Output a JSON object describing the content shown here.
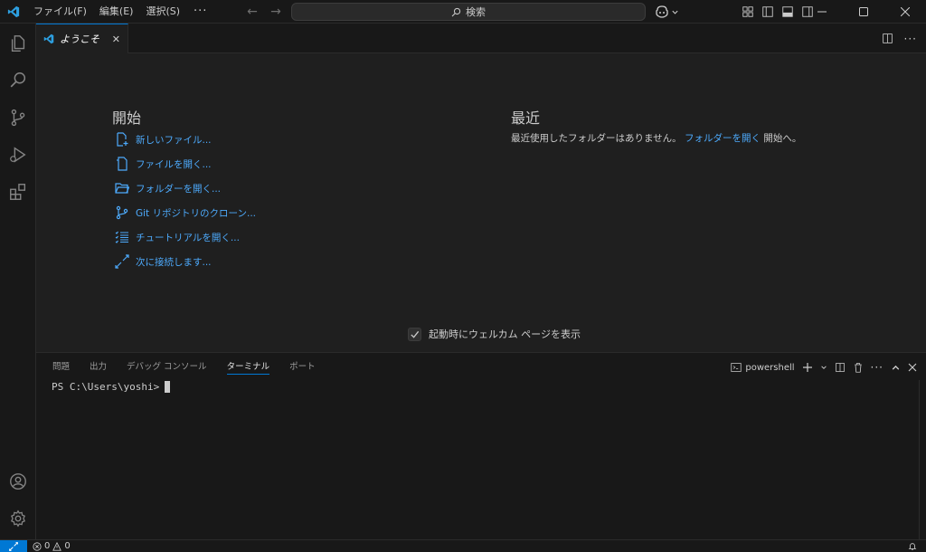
{
  "titlebar": {
    "menu": [
      "ファイル(F)",
      "編集(E)",
      "選択(S)"
    ],
    "more": "···",
    "search_label": "検索"
  },
  "tab": {
    "label": "ようこそ"
  },
  "welcome": {
    "start_title": "開始",
    "start_items": [
      {
        "icon": "new-file-icon",
        "label": "新しいファイル..."
      },
      {
        "icon": "open-file-icon",
        "label": "ファイルを開く..."
      },
      {
        "icon": "folder-open-icon",
        "label": "フォルダーを開く..."
      },
      {
        "icon": "git-clone-icon",
        "label": "Git リポジトリのクローン..."
      },
      {
        "icon": "checklist-icon",
        "label": "チュートリアルを開く..."
      },
      {
        "icon": "remote-connect-icon",
        "label": "次に接続します..."
      }
    ],
    "recent_title": "最近",
    "recent_text": "最近使用したフォルダーはありません。",
    "recent_link": "フォルダーを開く",
    "recent_suffix": "開始へ。",
    "show_on_startup": "起動時にウェルカム ページを表示"
  },
  "panel": {
    "tabs": [
      "問題",
      "出力",
      "デバッグ コンソール",
      "ターミナル",
      "ポート"
    ],
    "active_tab": "ターミナル",
    "shell": "powershell",
    "prompt": "PS C:\\Users\\yoshi>"
  },
  "status": {
    "errors": "0",
    "warnings": "0"
  },
  "colors": {
    "accent": "#0078d4",
    "link": "#4daafc",
    "background": "#1f1f1f",
    "sidebar": "#181818"
  }
}
